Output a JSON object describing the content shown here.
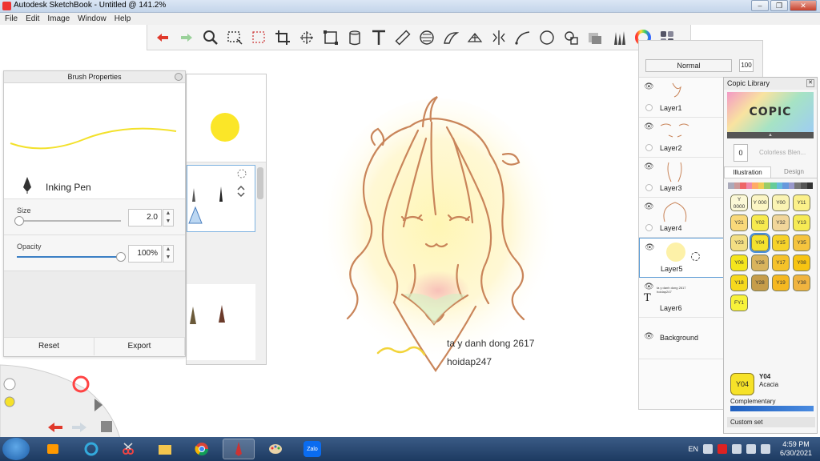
{
  "window": {
    "title": "Autodesk SketchBook - Untitled @ 141.2%",
    "buttons": [
      "–",
      "❐",
      "✕"
    ]
  },
  "menu": [
    "File",
    "Edit",
    "Image",
    "Window",
    "Help"
  ],
  "toolbar": {
    "tools": [
      "undo-icon",
      "redo-icon",
      "zoom-icon",
      "select-icon",
      "lasso-icon",
      "crop-icon",
      "transform-icon",
      "distort-icon",
      "fill-icon",
      "text-icon",
      "ruler-icon",
      "ellipse-guide-icon",
      "french-curve-icon",
      "perspective-icon",
      "symmetry-icon",
      "curve-icon",
      "shape-icon",
      "copy-icon",
      "layer-editor-icon",
      "brush-library-icon",
      "color-wheel-icon",
      "panels-icon"
    ]
  },
  "brush_properties": {
    "title": "Brush Properties",
    "brush_name": "Inking Pen",
    "size_label": "Size",
    "size_value": "2.0",
    "size_fraction": 0.02,
    "opacity_label": "Opacity",
    "opacity_value": "100%",
    "opacity_fraction": 1.0,
    "reset_label": "Reset",
    "export_label": "Export",
    "stroke_color": "#f3e12b"
  },
  "layers": {
    "blend_mode": "Normal",
    "opacity": "100",
    "items": [
      {
        "name": "Layer1",
        "selected": false
      },
      {
        "name": "Layer2",
        "selected": false
      },
      {
        "name": "Layer3",
        "selected": false
      },
      {
        "name": "Layer4",
        "selected": false
      },
      {
        "name": "Layer5",
        "selected": true
      },
      {
        "name": "Layer6",
        "selected": false
      },
      {
        "name": "Background",
        "selected": false
      }
    ],
    "layer6_text": "ta y danh dong 2617 hoidap247"
  },
  "copic": {
    "title": "Copic Library",
    "logo": "COPIC",
    "colorless_code": "0",
    "colorless_label": "Colorless Blen...",
    "tabs": [
      "Illustration",
      "Design"
    ],
    "active_tab": "Illustration",
    "swatches": [
      {
        "code": "Y 0000",
        "color": "#fbf8d6"
      },
      {
        "code": "Y 000",
        "color": "#fbf5c4"
      },
      {
        "code": "Y00",
        "color": "#faf3b3"
      },
      {
        "code": "Y11",
        "color": "#fbf08a"
      },
      {
        "code": "Y21",
        "color": "#f9d97a"
      },
      {
        "code": "Y02",
        "color": "#f7ea4f"
      },
      {
        "code": "Y32",
        "color": "#f1d69a"
      },
      {
        "code": "Y13",
        "color": "#f6ea54"
      },
      {
        "code": "Y23",
        "color": "#f3df83"
      },
      {
        "code": "Y04",
        "color": "#f4e12d"
      },
      {
        "code": "Y15",
        "color": "#f7d229"
      },
      {
        "code": "Y35",
        "color": "#f5c43e"
      },
      {
        "code": "Y06",
        "color": "#f4e51c"
      },
      {
        "code": "Y26",
        "color": "#d9b45d"
      },
      {
        "code": "Y17",
        "color": "#f5c22a"
      },
      {
        "code": "Y08",
        "color": "#f7c412"
      },
      {
        "code": "Y18",
        "color": "#f6d91d"
      },
      {
        "code": "Y28",
        "color": "#c69d4a"
      },
      {
        "code": "Y19",
        "color": "#f5b821"
      },
      {
        "code": "Y38",
        "color": "#f0b43f"
      },
      {
        "code": "FY1",
        "color": "#f7f23a"
      }
    ],
    "selected_code": "Y04",
    "selected_name": "Acacia",
    "complementary_label": "Complementary",
    "custom_set_label": "Custom set"
  },
  "canvas": {
    "text_line1": "ta y danh dong 2617",
    "text_line2": "hoidap247"
  },
  "taskbar": {
    "apps": [
      "explorer-icon",
      "media-icon",
      "ie-icon",
      "paint-icon",
      "folder-icon",
      "chrome-icon",
      "sketchbook-icon",
      "paint-palette-icon",
      "zalo-icon"
    ],
    "zalo_label": "Zalo",
    "lang": "EN",
    "time": "4:59 PM",
    "date": "6/30/2021"
  }
}
